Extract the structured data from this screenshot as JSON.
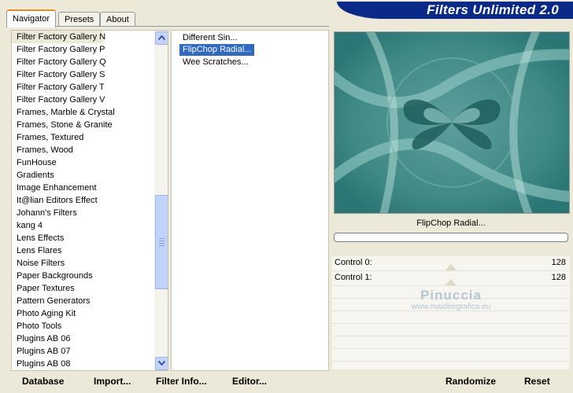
{
  "tabs": [
    {
      "label": "Navigator",
      "active": true
    },
    {
      "label": "Presets",
      "active": false
    },
    {
      "label": "About",
      "active": false
    }
  ],
  "banner": {
    "title": "Filters Unlimited 2.0"
  },
  "categories": {
    "selected_index": 0,
    "items": [
      "Filter Factory Gallery N",
      "Filter Factory Gallery P",
      "Filter Factory Gallery Q",
      "Filter Factory Gallery S",
      "Filter Factory Gallery T",
      "Filter Factory Gallery V",
      "Frames, Marble & Crystal",
      "Frames, Stone & Granite",
      "Frames, Textured",
      "Frames, Wood",
      "FunHouse",
      "Gradients",
      "Image Enhancement",
      "It@lian Editors Effect",
      "Johann's Filters",
      "kang 4",
      "Lens Effects",
      "Lens Flares",
      "Noise Filters",
      "Paper Backgrounds",
      "Paper Textures",
      "Pattern Generators",
      "Photo Aging Kit",
      "Photo Tools",
      "Plugins AB 06",
      "Plugins AB 07",
      "Plugins AB 08"
    ]
  },
  "filters": {
    "selected_index": 1,
    "items": [
      "Different Sin...",
      "FlipChop Radial...",
      "Wee Scratches..."
    ]
  },
  "preview": {
    "filter_name": "FlipChop Radial..."
  },
  "controls": [
    {
      "label": "Control 0:",
      "value": "128"
    },
    {
      "label": "Control 1:",
      "value": "128"
    }
  ],
  "watermark": {
    "line1": "Pinuccia",
    "line2": "www.maidiregrafica.eu"
  },
  "buttons": {
    "database": "Database",
    "import": "Import...",
    "filter_info": "Filter Info...",
    "editor": "Editor...",
    "randomize": "Randomize",
    "reset": "Reset"
  }
}
